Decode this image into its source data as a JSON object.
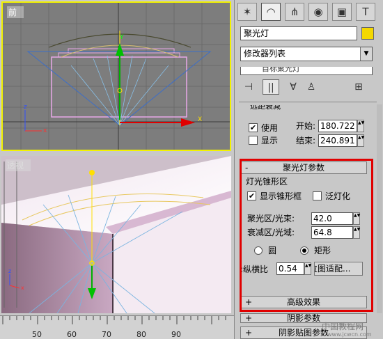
{
  "viewports": {
    "front_label": "前",
    "persp_label": "透视"
  },
  "ruler": {
    "ticks": [
      "50",
      "60",
      "70",
      "80",
      "90"
    ]
  },
  "panel": {
    "tabs": [
      {
        "name": "create-tab",
        "icon": "star-cursor-icon",
        "glyph": "✶"
      },
      {
        "name": "modify-tab",
        "icon": "rainbow-arc-icon",
        "glyph": "◠"
      },
      {
        "name": "hierarchy-tab",
        "icon": "hierarchy-icon",
        "glyph": "⋔"
      },
      {
        "name": "motion-tab",
        "icon": "motion-wheel-icon",
        "glyph": "◉"
      },
      {
        "name": "display-tab",
        "icon": "monitor-icon",
        "glyph": "▣"
      },
      {
        "name": "utilities-tab",
        "icon": "hammer-icon",
        "glyph": "T"
      }
    ],
    "object_name": "聚光灯",
    "object_color": "#f4d800",
    "modifier_list": "修改器列表",
    "stack_entry": "目标聚光灯"
  },
  "decay": {
    "header": "远距衰减",
    "use_label": "使用",
    "use_checked": true,
    "show_label": "显示",
    "show_checked": false,
    "start_label": "开始:",
    "start_value": "180.722",
    "end_label": "结束:",
    "end_value": "240.891"
  },
  "spotlight": {
    "rollout_title": "聚光灯参数",
    "group_title": "灯光锥形区",
    "show_cone_label": "显示锥形框",
    "show_cone_checked": true,
    "overshoot_label": "泛灯化",
    "overshoot_checked": false,
    "hotspot_label": "聚光区/光束:",
    "hotspot_value": "42.0",
    "falloff_label": "衰减区/光域:",
    "falloff_value": "64.8",
    "circle_label": "圆",
    "rect_label": "矩形",
    "shape_selected": "矩形",
    "aspect_label": "纵横比:",
    "aspect_value": "0.54",
    "bitmap_fit_label": "位图适配..."
  },
  "rollouts": {
    "advanced": "高级效果",
    "shadow_params": "阴影参数",
    "shadow_map_params": "阴影贴图参数"
  },
  "watermark": {
    "line1": "中国教程网",
    "line2": "www.jcwcn.com"
  },
  "colors": {
    "highlight": "#e00000",
    "viewport_border": "#f2f200"
  }
}
